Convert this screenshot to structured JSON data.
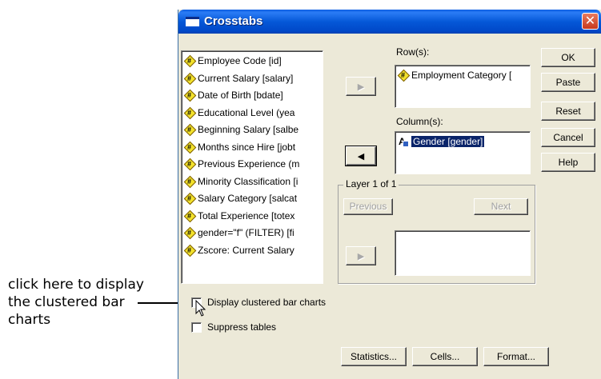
{
  "annotation": {
    "lines": [
      "click here to display",
      "the clustered bar",
      "charts"
    ]
  },
  "window": {
    "title": "Crosstabs",
    "close_glyph": "✕"
  },
  "variables": [
    "Employee Code [id]",
    "Current Salary [salary]",
    "Date of Birth [bdate]",
    "Educational Level (yea",
    "Beginning Salary [salbe",
    "Months since Hire [jobt",
    "Previous Experience (m",
    "Minority Classification [i",
    "Salary Category [salcat",
    "Total Experience [totex",
    "gender=\"f\" (FILTER) [fi",
    "Zscore:  Current Salary"
  ],
  "rows": {
    "label": "Row(s):",
    "items": [
      "Employment Category ["
    ]
  },
  "columns": {
    "label": "Column(s):",
    "items": [
      "Gender [gender]"
    ]
  },
  "layer": {
    "title": "Layer 1 of 1",
    "previous_label": "Previous",
    "next_label": "Next"
  },
  "buttons": {
    "ok": "OK",
    "paste": "Paste",
    "reset": "Reset",
    "cancel": "Cancel",
    "help": "Help",
    "statistics": "Statistics...",
    "cells": "Cells...",
    "format": "Format..."
  },
  "options": {
    "clustered_bar": "Display clustered bar charts",
    "suppress_tables": "Suppress tables",
    "clustered_bar_checked": false,
    "suppress_tables_checked": false
  },
  "arrows": {
    "right": "▶",
    "left": "◀"
  },
  "colors": {
    "title_bar": "#0558d8",
    "dialog_face": "#ece9d8",
    "selection": "#0a246a",
    "close_button": "#c8391c"
  }
}
